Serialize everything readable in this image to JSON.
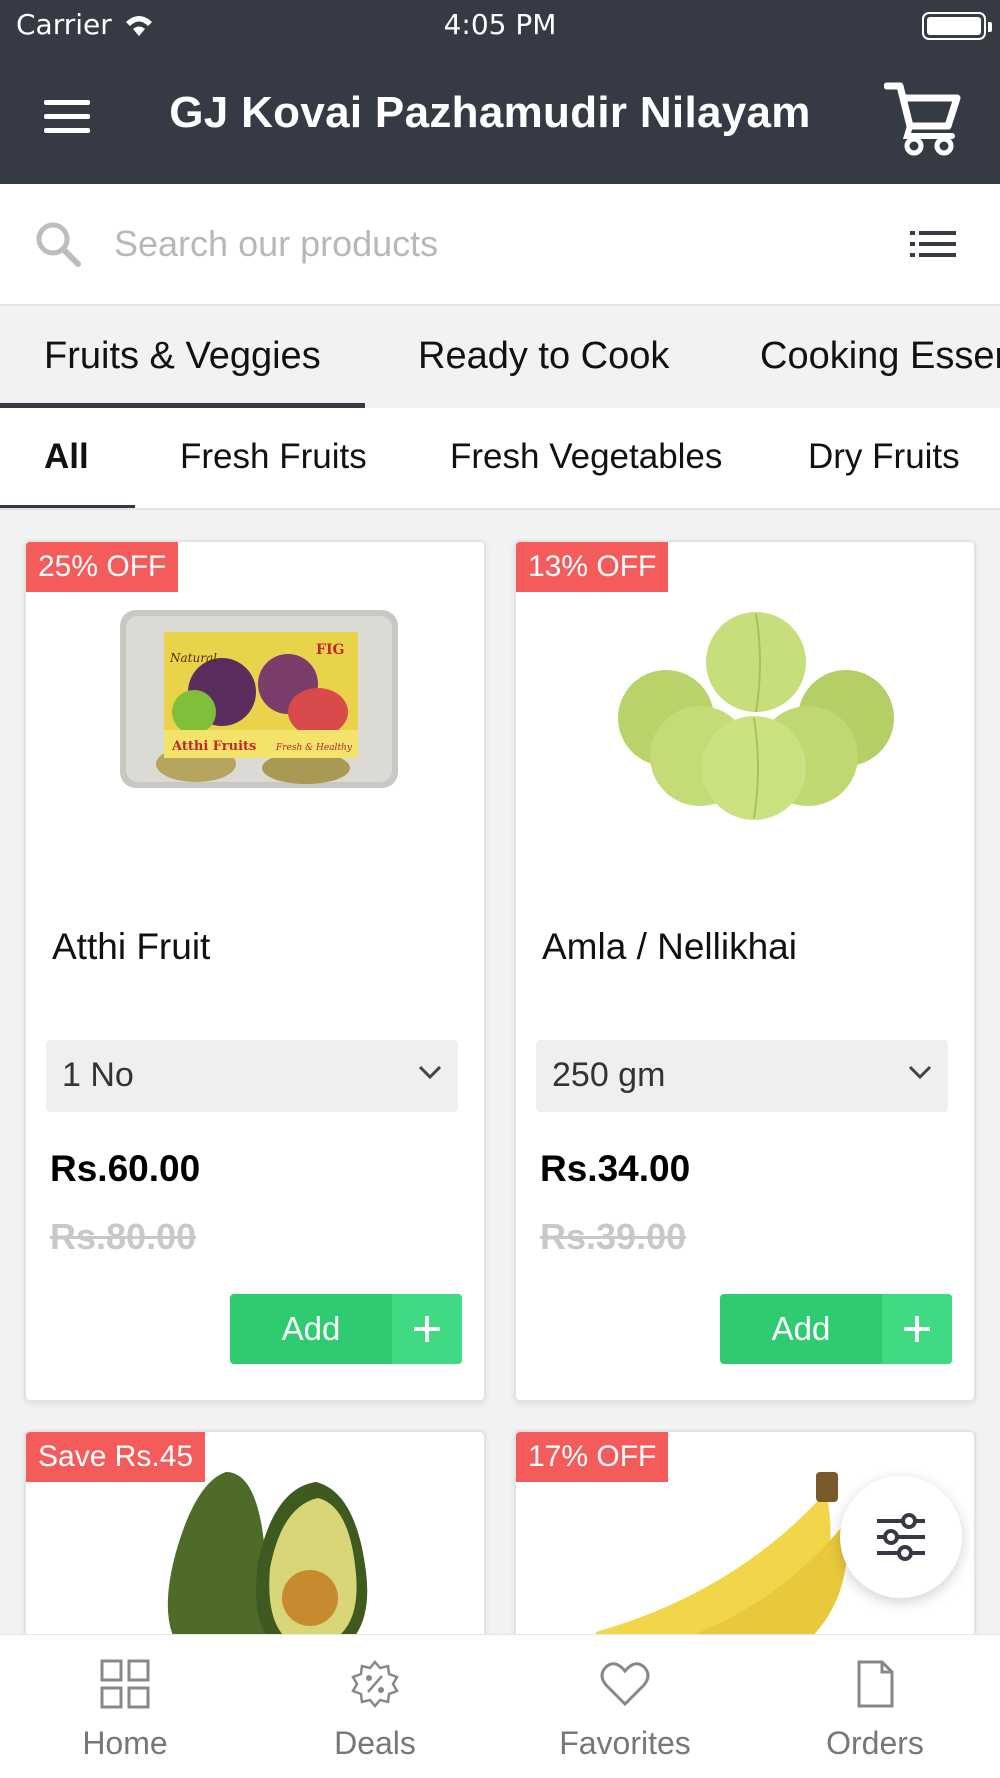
{
  "status_bar": {
    "carrier": "Carrier",
    "time": "4:05 PM"
  },
  "header": {
    "title": "GJ Kovai Pazhamudir Nilayam"
  },
  "search": {
    "placeholder": "Search our products"
  },
  "categories": [
    {
      "label": "Fruits & Veggies",
      "active": true
    },
    {
      "label": "Ready to Cook",
      "active": false
    },
    {
      "label": "Cooking Esser",
      "active": false
    }
  ],
  "subcategories": [
    {
      "label": "All",
      "active": true
    },
    {
      "label": "Fresh Fruits",
      "active": false
    },
    {
      "label": "Fresh Vegetables",
      "active": false
    },
    {
      "label": "Dry Fruits",
      "active": false
    }
  ],
  "products": [
    {
      "badge": "25% OFF",
      "name": "Atthi Fruit",
      "variant": "1 No",
      "price": "Rs.60.00",
      "old_price": "Rs.80.00",
      "add_label": "Add",
      "image_label_title": "FIG",
      "image_label_natural": "Natural",
      "image_label_brand": "Atthi Fruits",
      "image_label_tag": "Fresh & Healthy"
    },
    {
      "badge": "13% OFF",
      "name": "Amla / Nellikhai",
      "variant": "250 gm",
      "price": "Rs.34.00",
      "old_price": "Rs.39.00",
      "add_label": "Add"
    },
    {
      "badge": "Save Rs.45"
    },
    {
      "badge": "17% OFF"
    }
  ],
  "bottom_nav": [
    {
      "label": "Home",
      "icon": "grid-icon"
    },
    {
      "label": "Deals",
      "icon": "deals-badge-icon"
    },
    {
      "label": "Favorites",
      "icon": "heart-icon"
    },
    {
      "label": "Orders",
      "icon": "document-icon"
    }
  ],
  "colors": {
    "header_bg": "#363a45",
    "badge": "#f45c5c",
    "add_button": "#2ecb71",
    "add_plus": "#3fda82"
  }
}
